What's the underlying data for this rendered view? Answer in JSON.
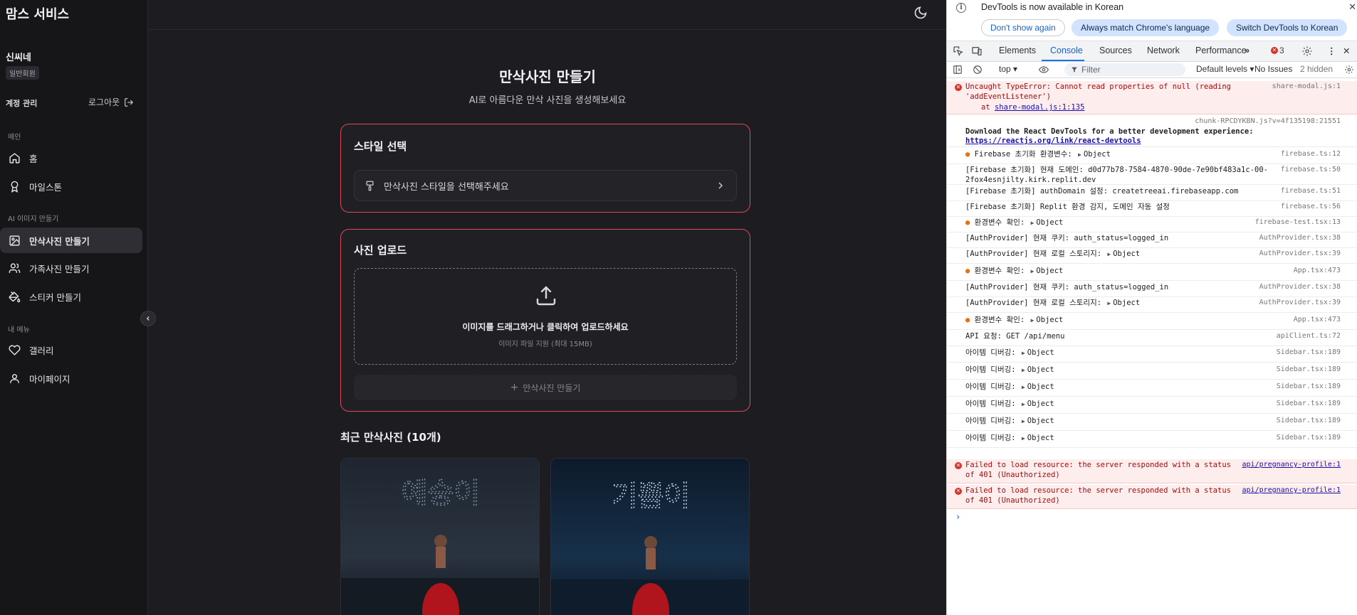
{
  "app": {
    "brand": "맘스 서비스",
    "user": {
      "name": "신씨네",
      "badge": "일반회원"
    },
    "account_label": "계정 관리",
    "logout_label": "로그아웃",
    "sections": {
      "main": "메인",
      "ai": "AI 이미지 만들기",
      "mine": "내 메뉴"
    },
    "nav": {
      "home": "홈",
      "milestone": "마일스톤",
      "maternity": "만삭사진 만들기",
      "family": "가족사진 만들기",
      "sticker": "스티커 만들기",
      "gallery": "갤러리",
      "mypage": "마이페이지"
    },
    "page": {
      "title": "만삭사진 만들기",
      "subtitle": "AI로 아름다운 만삭 사진을 생성해보세요",
      "style_card_title": "스타일 선택",
      "style_placeholder": "만삭사진 스타일을 선택해주세요",
      "upload_card_title": "사진 업로드",
      "upload_main": "이미지를 드래그하거나 클릭하여 업로드하세요",
      "upload_hint": "이미지 파일 지원 (최대 15MB)",
      "create_button": "만삭사진 만들기",
      "recent_title": "최근 만삭사진 (10개)",
      "thumbs": [
        {
          "sky_text": "예승이"
        },
        {
          "sky_text": "기쁨이"
        }
      ]
    }
  },
  "devtools": {
    "info_message": "DevTools is now available in Korean",
    "buttons": {
      "dont_show": "Don't show again",
      "always_match": "Always match Chrome's language",
      "switch": "Switch DevTools to Korean"
    },
    "tabs": {
      "elements": "Elements",
      "console": "Console",
      "sources": "Sources",
      "network": "Network",
      "performance": "Performance"
    },
    "error_count": "3",
    "toolbar": {
      "context": "top",
      "filter_placeholder": "Filter",
      "levels": "Default levels",
      "issues": "No Issues",
      "hidden": "2 hidden"
    },
    "logs": {
      "l1": {
        "text": "Uncaught TypeError: Cannot read properties of null (reading\n'addEventListener')",
        "at": "at ",
        "at_link": "share-modal.js:1:135",
        "src": "share-modal.js:1"
      },
      "l2": {
        "src": "chunk-RPCDYKBN.js?v=4f135198:21551",
        "text": "Download the React DevTools for a better development experience:",
        "link": "https://reactjs.org/link/react-devtools"
      },
      "l3": {
        "text": "Firebase 초기화 환경변수:",
        "obj": "Object",
        "src": "firebase.ts:12"
      },
      "l4": {
        "text": "[Firebase 초기화] 현재 도메인: d0d77b78-7584-4870-90de-7e90bf483a1c-00-\n2fox4esnjilty.kirk.replit.dev",
        "src": "firebase.ts:50"
      },
      "l5": {
        "text": "[Firebase 초기화] authDomain 설정: createtreeai.firebaseapp.com",
        "src": "firebase.ts:51"
      },
      "l6": {
        "text": "[Firebase 초기화] Replit 환경 감지, 도메인 자동 설정",
        "src": "firebase.ts:56"
      },
      "l7": {
        "text": "환경변수 확인:",
        "obj": "Object",
        "src": "firebase-test.tsx:13"
      },
      "l8": {
        "text": "[AuthProvider] 현재 쿠키: auth_status=logged_in",
        "src": "AuthProvider.tsx:38"
      },
      "l9": {
        "text": "[AuthProvider] 현재 로컬 스토리지:",
        "obj": "Object",
        "src": "AuthProvider.tsx:39"
      },
      "l10": {
        "text": "환경변수 확인:",
        "obj": "Object",
        "src": "App.tsx:473"
      },
      "l11": {
        "text": "[AuthProvider] 현재 쿠키: auth_status=logged_in",
        "src": "AuthProvider.tsx:38"
      },
      "l12": {
        "text": "[AuthProvider] 현재 로컬 스토리지:",
        "obj": "Object",
        "src": "AuthProvider.tsx:39"
      },
      "l13": {
        "text": "환경변수 확인:",
        "obj": "Object",
        "src": "App.tsx:473"
      },
      "l14": {
        "text": "API 요청: GET /api/menu",
        "src": "apiClient.ts:72"
      },
      "item_debug": {
        "text": "아이템 디버깅:",
        "obj": "Object",
        "src": "Sidebar.tsx:189"
      },
      "e1": {
        "text": "Failed to load resource: the server responded with a status\nof 401 (Unauthorized)",
        "src": "api/pregnancy-profile:1"
      },
      "e2": {
        "text": "Failed to load resource: the server responded with a status\nof 401 (Unauthorized)",
        "src": "api/pregnancy-profile:1"
      }
    }
  }
}
